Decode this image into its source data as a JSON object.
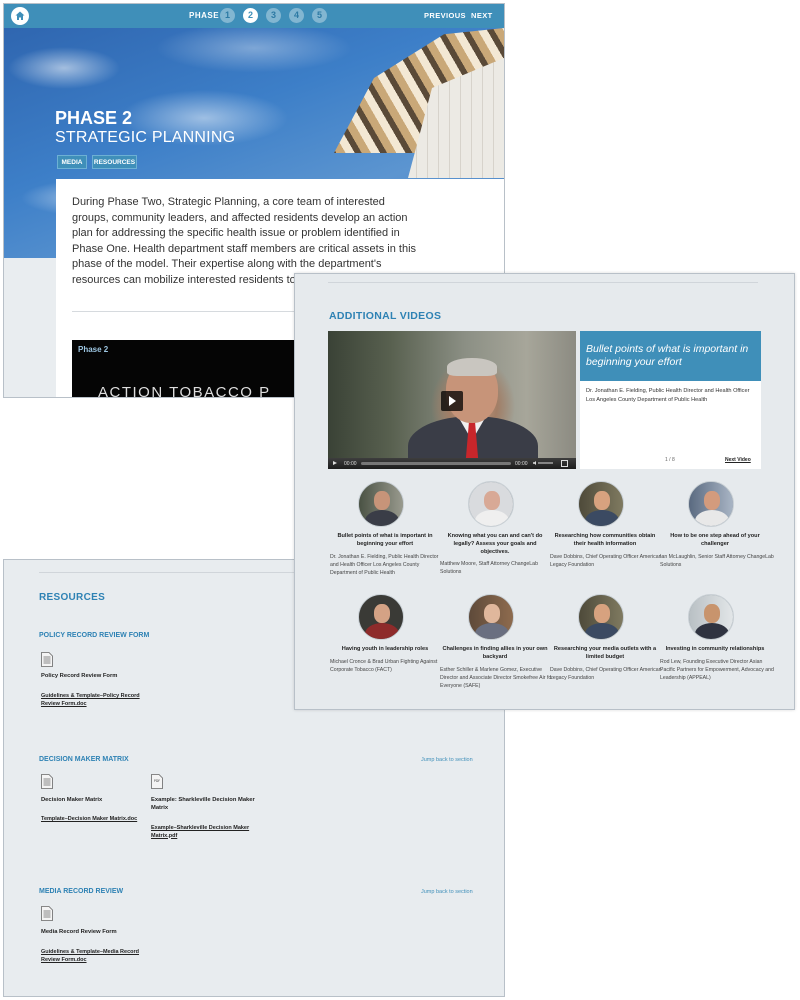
{
  "phase_page": {
    "nav": {
      "phase_label": "PHASE",
      "phases": [
        "1",
        "2",
        "3",
        "4",
        "5"
      ],
      "active_phase": "2",
      "previous_label": "PREVIOUS",
      "next_label": "NEXT"
    },
    "hero": {
      "title": "PHASE 2",
      "subtitle": "STRATEGIC PLANNING",
      "media_button": "MEDIA",
      "resources_button": "RESOURCES"
    },
    "intro_text": "During Phase Two, Strategic Planning, a core team of interested groups, community leaders, and affected residents develop an action plan for addressing the specific health issue or problem identified in Phase One. Health department staff members are critical assets in this phase of the model. Their expertise along with the department's resources can mobilize interested residents to successfully lead the pr",
    "video_thumb": {
      "label": "Phase 2",
      "text": "ACTION TOBACCO  P"
    }
  },
  "resources_page": {
    "title": "RESOURCES",
    "sections": [
      {
        "title": "POLICY RECORD REVIEW FORM",
        "items": [
          {
            "title": "Policy Record Review Form",
            "link": "Guidelines & Template–Policy Record Review Form.doc",
            "type": "doc"
          }
        ]
      },
      {
        "title": "DECISION MAKER MATRIX",
        "jump_link": "Jump back to section",
        "items": [
          {
            "title": "Decision Maker Matrix",
            "link": "Template–Decision Maker Matrix.doc",
            "type": "doc"
          },
          {
            "title": "Example: Sharkleville Decision Maker Matrix",
            "link": "Example–Sharkleville Decision Maker Matrix.pdf",
            "type": "pdf"
          }
        ]
      },
      {
        "title": "MEDIA RECORD REVIEW",
        "jump_link": "Jump back to section",
        "items": [
          {
            "title": "Media Record Review Form",
            "link": "Guidelines & Template–Media Record Review Form.doc",
            "type": "doc"
          }
        ]
      }
    ],
    "pdf_badge": "PDF"
  },
  "videos_page": {
    "title": "ADDITIONAL VIDEOS",
    "player": {
      "current_time": "00:00",
      "duration": "00:00"
    },
    "info": {
      "heading": "Bullet points of what is important in beginning your effort",
      "description": "Dr. Jonathan E. Fielding, Public Health Director and Health Officer Los Angeles County Department of Public Health",
      "counter": "1 / 8",
      "next_label": "Next Video"
    },
    "thumbnails": [
      {
        "title": "Bullet points of what is important in beginning your effort",
        "credit": "Dr. Jonathan E. Fielding, Public Health Director and Health Officer Los Angeles County Department of Public Health"
      },
      {
        "title": "Knowing what you can and can't do legally? Assess your goals and objectives.",
        "credit": "Matthew Moore, Staff Attorney ChangeLab Solutions"
      },
      {
        "title": "Researching how communities obtain their health information",
        "credit": "Dave Dobbins, Chief Operating Officer American Legacy Foundation"
      },
      {
        "title": "How to be one step ahead of your challenger",
        "credit": "Ian McLaughlin, Senior Staff Attorney ChangeLab Solutions"
      },
      {
        "title": "Having youth in leadership roles",
        "credit": "Michael Cronce & Brad Urban Fighting Against Corporate Tobacco (FACT)"
      },
      {
        "title": "Challenges in finding allies in your own backyard",
        "credit": "Esther Schiller & Marlene Gomez, Executive Director and Associate Director Smokefree Air for Everyone (SAFE)"
      },
      {
        "title": "Researching your media outlets with a limited budget",
        "credit": "Dave Dobbins, Chief Operating Officer American Legacy Foundation"
      },
      {
        "title": "Investing in community relationships",
        "credit": "Rod Lew, Founding Executive Director Asian Pacific Partners for Empowerment, Advocacy and Leadership (APPEAL)"
      }
    ]
  },
  "colors": {
    "accent": "#3f8fb9",
    "heading_blue": "#2e82b4",
    "panel_bg": "#e8ecef"
  }
}
